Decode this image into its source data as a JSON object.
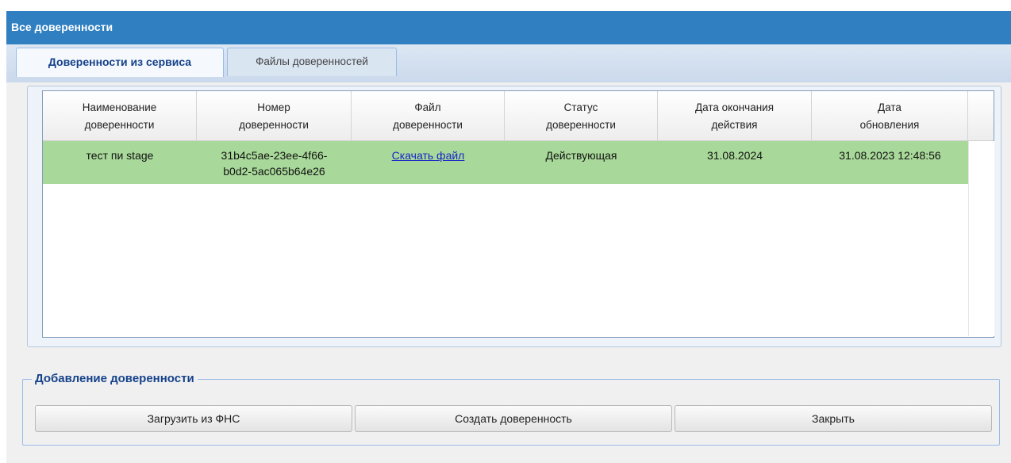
{
  "window": {
    "title": "Все доверенности"
  },
  "tabs": [
    {
      "label": "Доверенности из сервиса",
      "active": true
    },
    {
      "label": "Файлы доверенностей",
      "active": false
    }
  ],
  "table": {
    "headers": [
      [
        "Наименование",
        "доверенности"
      ],
      [
        "Номер",
        "доверенности"
      ],
      [
        "Файл",
        "доверенности"
      ],
      [
        "Статус",
        "доверенности"
      ],
      [
        "Дата окончания",
        "действия"
      ],
      [
        "Дата",
        "обновления"
      ]
    ],
    "rows": [
      {
        "name": "тест пи stage",
        "number_line1": "31b4c5ae-23ee-4f66-",
        "number_line2": "b0d2-5ac065b64e26",
        "file_link": "Скачать файл",
        "status": "Действующая",
        "end_date": "31.08.2024",
        "updated": "31.08.2023 12:48:56"
      }
    ]
  },
  "add_section": {
    "legend": "Добавление доверенности",
    "buttons": {
      "load_fns": "Загрузить из ФНС",
      "create": "Создать доверенность",
      "close": "Закрыть"
    }
  },
  "colors": {
    "titlebar": "#2f7fc1",
    "selected_row": "#a9d99a",
    "link": "#1a23c8",
    "accent_text": "#15428b"
  }
}
